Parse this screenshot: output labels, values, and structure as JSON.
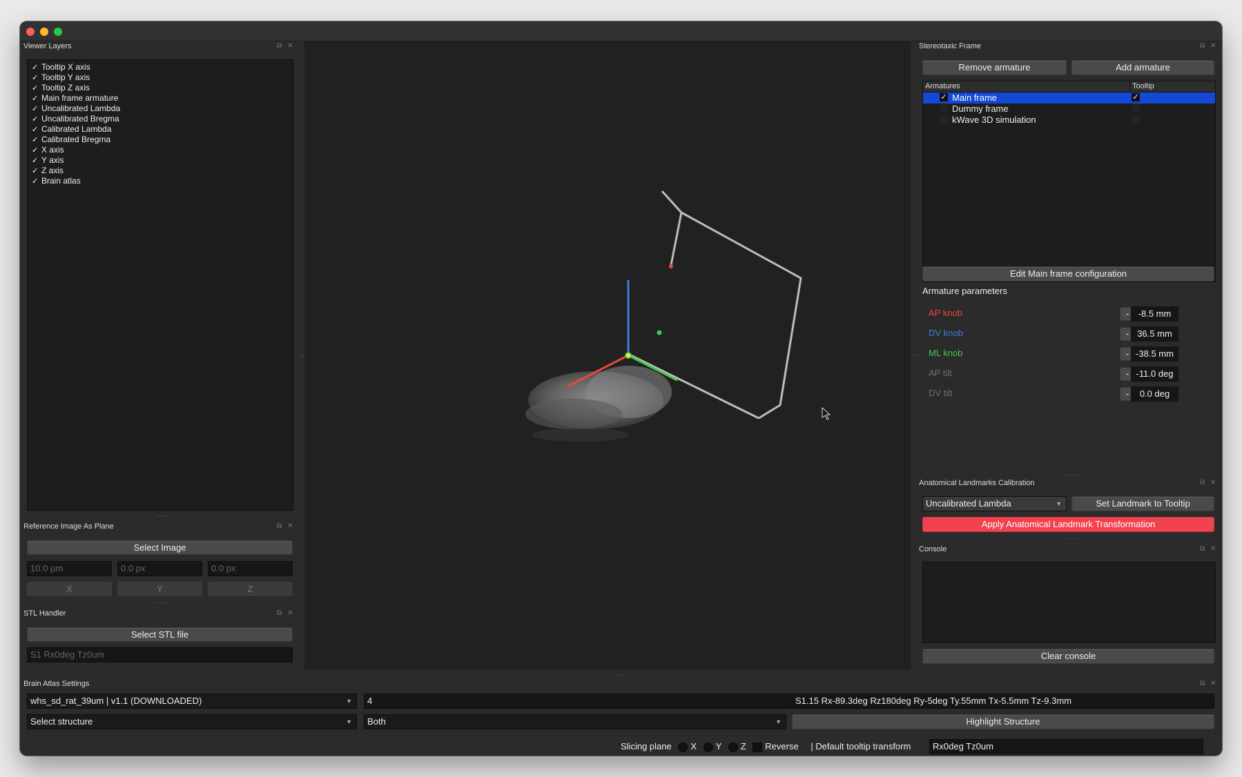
{
  "colors": {
    "accent_selection": "#1449d6",
    "danger_button": "#f0434f",
    "ap_knob": "#e84a3c",
    "dv_knob": "#3b7fe0",
    "ml_knob": "#45c84a",
    "disabled_text": "#6f6f6f"
  },
  "viewer_layers": {
    "title": "Viewer Layers",
    "items": [
      {
        "label": "Tooltip X axis",
        "checked": true
      },
      {
        "label": "Tooltip Y axis",
        "checked": true
      },
      {
        "label": "Tooltip Z axis",
        "checked": true
      },
      {
        "label": "Main frame armature",
        "checked": true
      },
      {
        "label": "Uncalibrated Lambda",
        "checked": true
      },
      {
        "label": "Uncalibrated Bregma",
        "checked": true
      },
      {
        "label": "Calibrated Lambda",
        "checked": true
      },
      {
        "label": "Calibrated Bregma",
        "checked": true
      },
      {
        "label": "X axis",
        "checked": true
      },
      {
        "label": "Y axis",
        "checked": true
      },
      {
        "label": "Z axis",
        "checked": true
      },
      {
        "label": "Brain atlas",
        "checked": true
      }
    ]
  },
  "reference_image": {
    "title": "Reference Image As Plane",
    "select_label": "Select Image",
    "resolution_placeholder": "10.0 µm",
    "offset1_placeholder": "0.0 px",
    "offset2_placeholder": "0.0 px",
    "axis_buttons": [
      "X",
      "Y",
      "Z"
    ]
  },
  "stl_handler": {
    "title": "STL Handler",
    "select_label": "Select STL file",
    "transform_placeholder": "S1 Rx0deg Tz0um"
  },
  "stereotaxic": {
    "title": "Stereotaxic Frame",
    "remove_label": "Remove armature",
    "add_label": "Add armature",
    "col_armatures": "Armatures",
    "col_tooltip": "Tooltip",
    "armatures": [
      {
        "name": "Main frame",
        "enabled": true,
        "tooltip": true,
        "selected": true
      },
      {
        "name": "Dummy frame",
        "enabled": false,
        "tooltip": false,
        "selected": false
      },
      {
        "name": "kWave 3D simulation",
        "enabled": false,
        "tooltip": false,
        "selected": false
      }
    ],
    "edit_label": "Edit Main frame configuration",
    "params_title": "Armature parameters",
    "params": [
      {
        "label": "AP knob",
        "value": "-8.5 mm"
      },
      {
        "label": "DV knob",
        "value": "36.5 mm"
      },
      {
        "label": "ML knob",
        "value": "-38.5 mm"
      },
      {
        "label": "AP tilt",
        "value": "-11.0 deg"
      },
      {
        "label": "DV tilt",
        "value": "0.0 deg"
      }
    ],
    "minus": "-",
    "plus": "+"
  },
  "landmarks": {
    "title": "Anatomical Landmarks Calibration",
    "selected_landmark": "Uncalibrated Lambda",
    "set_label": "Set Landmark to Tooltip",
    "apply_label": "Apply Anatomical Landmark Transformation"
  },
  "console": {
    "title": "Console",
    "clear_label": "Clear console"
  },
  "atlas": {
    "title": "Brain Atlas Settings",
    "atlas_name": "whs_sd_rat_39um | v1.1 (DOWNLOADED)",
    "value_field": "4",
    "transform": "S1.15 Rx-89.3deg Rz180deg Ry-5deg Ty.55mm Tx-5.5mm Tz-9.3mm",
    "structure": "Select structure",
    "hemisphere": "Both",
    "highlight_label": "Highlight Structure"
  },
  "statusbar": {
    "slicing_label": "Slicing plane",
    "x": "X",
    "y": "Y",
    "z": "Z",
    "reverse": "Reverse",
    "default_transform_label": "|  Default tooltip transform",
    "default_transform_value": "Rx0deg Tz0um"
  }
}
